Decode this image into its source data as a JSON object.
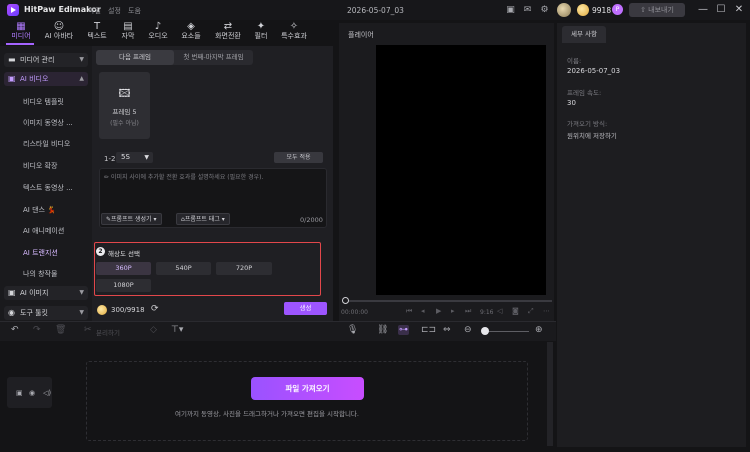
{
  "titlebar": {
    "app_name": "HitPaw Edimakor",
    "menu": [
      "파일",
      "설정",
      "도움"
    ],
    "doc_title": "2026-05-07_03",
    "credits": "9918",
    "vip_badge": "P",
    "export_label": "내보내기"
  },
  "tool_tabs": [
    {
      "label": "미디어",
      "icon": "media-icon"
    },
    {
      "label": "AI 아바타",
      "icon": "avatar-icon"
    },
    {
      "label": "텍스트",
      "icon": "text-icon"
    },
    {
      "label": "자막",
      "icon": "subtitle-icon"
    },
    {
      "label": "오디오",
      "icon": "audio-icon"
    },
    {
      "label": "요소들",
      "icon": "elements-icon"
    },
    {
      "label": "화면전환",
      "icon": "transition-icon"
    },
    {
      "label": "필터",
      "icon": "filter-icon"
    },
    {
      "label": "특수효과",
      "icon": "effects-icon"
    }
  ],
  "sidebar": {
    "groups": [
      {
        "label": "미디어 관리"
      },
      {
        "label": "AI 비디오"
      },
      {
        "label": "AI 이미지"
      },
      {
        "label": "도구 툴킷"
      }
    ],
    "ai_video_items": [
      "비디오 템플릿",
      "이미지 동영상 ...",
      "리스타일 비디오",
      "비디오 확장",
      "텍스트 동영상 ...",
      "AI 댄스 💃",
      "AI 애니메이션",
      "AI 트랜지션",
      "나의 창작물"
    ]
  },
  "config": {
    "segment_tabs": [
      "다음 프레임",
      "첫 번째-마지막 프레임"
    ],
    "frame_card": {
      "title": "프레임 5",
      "subtitle": "(필수 아님)"
    },
    "range_label": "1-2",
    "duration": "5S",
    "add_transition": "모두 적용",
    "prompt_placeholder": "✏ 이미지 사이에 추가할 전환 효과를 설명하세요 (필요한 경우).",
    "prompt_generator": "프롬프트 생성기",
    "prompt_tags": "프롬프트 태그",
    "char_count": "0/2000",
    "resolution": {
      "step": "2",
      "title": "해상도 선택",
      "options": [
        "360P",
        "540P",
        "720P",
        "1080P"
      ],
      "selected": "360P"
    },
    "credits": "300/9918",
    "generate_label": "생성"
  },
  "player": {
    "label": "플레이어",
    "time_left": "00:00:00",
    "time_right": "9:16"
  },
  "right_panel": {
    "tab": "세부 사항",
    "name_label": "이름:",
    "name_value": "2026-05-07_03",
    "fps_label": "프레임 속도:",
    "fps_value": "30",
    "import_label": "가져오기 방식:",
    "import_value": "원위치에 저장하기"
  },
  "timeline": {
    "split_label": "분리하기",
    "import_button": "파일 가져오기",
    "drop_hint": "여기까지 동영상, 사진을 드래그하거나 가져오면 편집을 시작합니다."
  }
}
